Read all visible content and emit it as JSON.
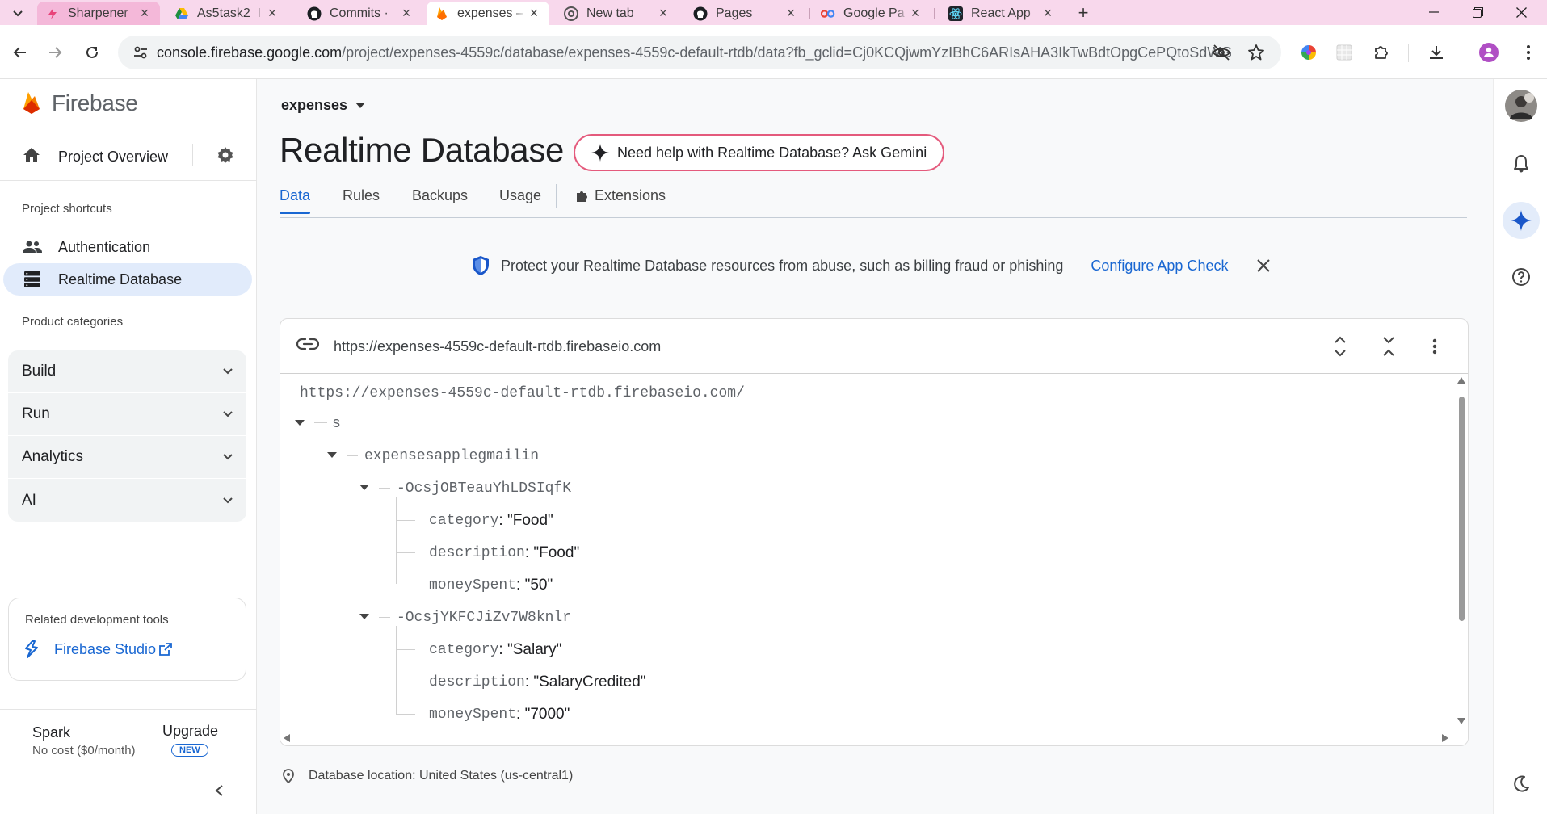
{
  "browser": {
    "tabs": [
      {
        "title": "Sharpener",
        "icon": "sharpener-icon"
      },
      {
        "title": "As5task2_I",
        "icon": "google-drive-icon"
      },
      {
        "title": "Commits ·",
        "icon": "github-icon"
      },
      {
        "title": "expenses –",
        "icon": "firebase-icon"
      },
      {
        "title": "New tab",
        "icon": "chrome-icon"
      },
      {
        "title": "Pages",
        "icon": "github-icon"
      },
      {
        "title": "Google Pa",
        "icon": "google-icon"
      },
      {
        "title": "React App",
        "icon": "react-icon"
      }
    ],
    "active_tab_index": 3,
    "url_host": "console.firebase.google.com",
    "url_path": "/project/expenses-4559c/database/expenses-4559c-default-rtdb/data?fb_gclid=Cj0KCQjwmYzIBhC6ARIsAHA3IkTwBdtOpgCePQtoSdWGc..."
  },
  "sidebar": {
    "brand": "Firebase",
    "project_overview": "Project Overview",
    "shortcuts_heading": "Project shortcuts",
    "shortcuts": [
      {
        "label": "Authentication",
        "icon": "people-icon",
        "selected": false
      },
      {
        "label": "Realtime Database",
        "icon": "database-icon",
        "selected": true
      }
    ],
    "categories_heading": "Product categories",
    "categories": [
      "Build",
      "Run",
      "Analytics",
      "AI"
    ],
    "related_heading": "Related development tools",
    "studio_label": "Firebase Studio",
    "plan_name": "Spark",
    "plan_cost": "No cost ($0/month)",
    "upgrade_label": "Upgrade",
    "upgrade_badge": "NEW"
  },
  "main": {
    "project_name": "expenses",
    "page_title": "Realtime Database",
    "gemini_label": "Need help with Realtime Database? Ask Gemini",
    "tabs": [
      "Data",
      "Rules",
      "Backups",
      "Usage",
      "Extensions"
    ],
    "active_tab": "Data",
    "banner_text": "Protect your Realtime Database resources from abuse, such as billing fraud or phishing",
    "banner_action": "Configure App Check",
    "db_url": "https://expenses-4559c-default-rtdb.firebaseio.com",
    "tree_root": "https://expenses-4559c-default-rtdb.firebaseio.com/",
    "tree": {
      "n1": "s",
      "n2": "expensesapplegmailin",
      "e1": {
        "id": "-OcsjOBTeauYhLDSIqfK",
        "category_key": "category",
        "category_val": "\"Food\"",
        "description_key": "description",
        "description_val": "\"Food\"",
        "money_key": "moneySpent",
        "money_val": "\"50\""
      },
      "e2": {
        "id": "-OcsjYKFCJiZv7W8knlr",
        "category_key": "category",
        "category_val": "\"Salary\"",
        "description_key": "description",
        "description_val": "\"SalaryCredited\"",
        "money_key": "moneySpent",
        "money_val": "\"7000\""
      }
    },
    "location": "Database location: United States (us-central1)"
  },
  "colors": {
    "accent": "#1967d2",
    "selected_nav_bg": "#e1ebfb",
    "tab_strip": "#f8d8ec",
    "gemini_border": "#e45a7c"
  }
}
